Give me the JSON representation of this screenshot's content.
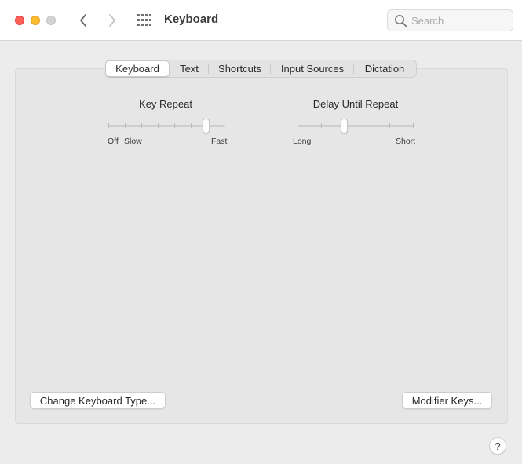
{
  "window": {
    "title": "Keyboard",
    "traffic_lights": {
      "close_color": "#ff5f57",
      "minimize_color": "#febc2e",
      "zoom_color": "#d3d3d3"
    }
  },
  "toolbar": {
    "back_icon": "chevron-left-icon",
    "forward_icon": "chevron-right-icon",
    "show_all_icon": "grid-icon",
    "search_placeholder": "Search",
    "search_value": ""
  },
  "tabs": [
    {
      "label": "Keyboard",
      "selected": true
    },
    {
      "label": "Text",
      "selected": false
    },
    {
      "label": "Shortcuts",
      "selected": false
    },
    {
      "label": "Input Sources",
      "selected": false
    },
    {
      "label": "Dictation",
      "selected": false
    }
  ],
  "key_repeat": {
    "title": "Key Repeat",
    "label_off": "Off",
    "label_slow": "Slow",
    "label_fast": "Fast",
    "tick_count": 8,
    "selected_step": 6
  },
  "delay_until_repeat": {
    "title": "Delay Until Repeat",
    "label_long": "Long",
    "label_short": "Short",
    "tick_count": 6,
    "selected_step": 2
  },
  "buttons": {
    "change_keyboard_type": "Change Keyboard Type...",
    "modifier_keys": "Modifier Keys..."
  },
  "help": {
    "label": "?"
  }
}
